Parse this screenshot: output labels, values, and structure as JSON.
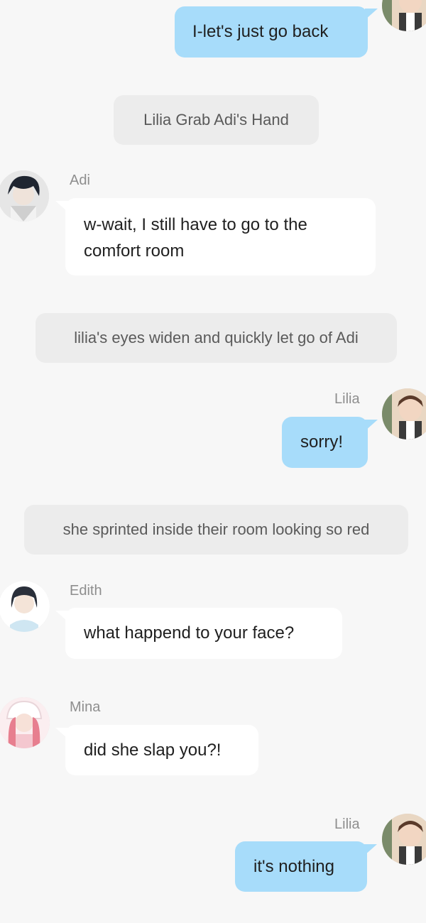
{
  "chat": {
    "messages": [
      {
        "id": "m1",
        "type": "outgoing",
        "text": "I-let's just go back"
      },
      {
        "id": "m2",
        "type": "narration",
        "text": "Lilia Grab Adi's Hand"
      },
      {
        "id": "m3",
        "type": "incoming",
        "sender": "Adi",
        "text_line1": "w-wait, I still have to go to the",
        "text_line2": "comfort room"
      },
      {
        "id": "m4",
        "type": "narration",
        "text": "lilia's eyes widen and quickly let go of Adi"
      },
      {
        "id": "m5",
        "type": "outgoing",
        "sender": "Lilia",
        "text": "sorry!"
      },
      {
        "id": "m6",
        "type": "narration",
        "text": "she sprinted inside their room looking so red"
      },
      {
        "id": "m7",
        "type": "incoming",
        "sender": "Edith",
        "text": "what happend to your face?"
      },
      {
        "id": "m8",
        "type": "incoming",
        "sender": "Mina",
        "text": "did she  slap you?!"
      },
      {
        "id": "m9",
        "type": "outgoing",
        "sender": "Lilia",
        "text": "it's nothing"
      }
    ]
  },
  "avatars": {
    "lilia": "lilia-avatar",
    "adi": "adi-avatar",
    "edith": "edith-avatar",
    "mina": "mina-avatar"
  },
  "colors": {
    "background": "#f7f7f7",
    "outgoing_bubble": "#a7dcfa",
    "incoming_bubble": "#ffffff",
    "narration_bubble": "#ececec",
    "sender_name": "#8e8e8e"
  }
}
